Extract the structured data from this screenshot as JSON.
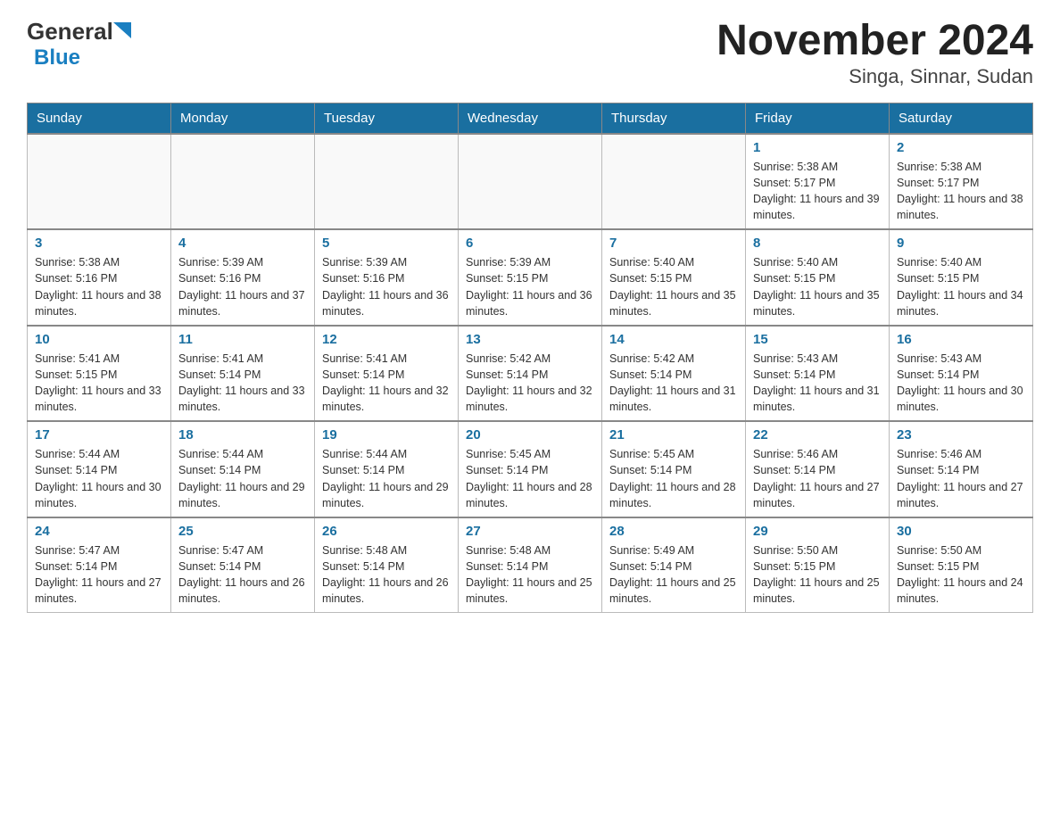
{
  "header": {
    "logo_general": "General",
    "logo_blue": "Blue",
    "title": "November 2024",
    "subtitle": "Singa, Sinnar, Sudan"
  },
  "calendar": {
    "days_of_week": [
      "Sunday",
      "Monday",
      "Tuesday",
      "Wednesday",
      "Thursday",
      "Friday",
      "Saturday"
    ],
    "weeks": [
      {
        "days": [
          {
            "date": "",
            "info": ""
          },
          {
            "date": "",
            "info": ""
          },
          {
            "date": "",
            "info": ""
          },
          {
            "date": "",
            "info": ""
          },
          {
            "date": "",
            "info": ""
          },
          {
            "date": "1",
            "info": "Sunrise: 5:38 AM\nSunset: 5:17 PM\nDaylight: 11 hours and 39 minutes."
          },
          {
            "date": "2",
            "info": "Sunrise: 5:38 AM\nSunset: 5:17 PM\nDaylight: 11 hours and 38 minutes."
          }
        ]
      },
      {
        "days": [
          {
            "date": "3",
            "info": "Sunrise: 5:38 AM\nSunset: 5:16 PM\nDaylight: 11 hours and 38 minutes."
          },
          {
            "date": "4",
            "info": "Sunrise: 5:39 AM\nSunset: 5:16 PM\nDaylight: 11 hours and 37 minutes."
          },
          {
            "date": "5",
            "info": "Sunrise: 5:39 AM\nSunset: 5:16 PM\nDaylight: 11 hours and 36 minutes."
          },
          {
            "date": "6",
            "info": "Sunrise: 5:39 AM\nSunset: 5:15 PM\nDaylight: 11 hours and 36 minutes."
          },
          {
            "date": "7",
            "info": "Sunrise: 5:40 AM\nSunset: 5:15 PM\nDaylight: 11 hours and 35 minutes."
          },
          {
            "date": "8",
            "info": "Sunrise: 5:40 AM\nSunset: 5:15 PM\nDaylight: 11 hours and 35 minutes."
          },
          {
            "date": "9",
            "info": "Sunrise: 5:40 AM\nSunset: 5:15 PM\nDaylight: 11 hours and 34 minutes."
          }
        ]
      },
      {
        "days": [
          {
            "date": "10",
            "info": "Sunrise: 5:41 AM\nSunset: 5:15 PM\nDaylight: 11 hours and 33 minutes."
          },
          {
            "date": "11",
            "info": "Sunrise: 5:41 AM\nSunset: 5:14 PM\nDaylight: 11 hours and 33 minutes."
          },
          {
            "date": "12",
            "info": "Sunrise: 5:41 AM\nSunset: 5:14 PM\nDaylight: 11 hours and 32 minutes."
          },
          {
            "date": "13",
            "info": "Sunrise: 5:42 AM\nSunset: 5:14 PM\nDaylight: 11 hours and 32 minutes."
          },
          {
            "date": "14",
            "info": "Sunrise: 5:42 AM\nSunset: 5:14 PM\nDaylight: 11 hours and 31 minutes."
          },
          {
            "date": "15",
            "info": "Sunrise: 5:43 AM\nSunset: 5:14 PM\nDaylight: 11 hours and 31 minutes."
          },
          {
            "date": "16",
            "info": "Sunrise: 5:43 AM\nSunset: 5:14 PM\nDaylight: 11 hours and 30 minutes."
          }
        ]
      },
      {
        "days": [
          {
            "date": "17",
            "info": "Sunrise: 5:44 AM\nSunset: 5:14 PM\nDaylight: 11 hours and 30 minutes."
          },
          {
            "date": "18",
            "info": "Sunrise: 5:44 AM\nSunset: 5:14 PM\nDaylight: 11 hours and 29 minutes."
          },
          {
            "date": "19",
            "info": "Sunrise: 5:44 AM\nSunset: 5:14 PM\nDaylight: 11 hours and 29 minutes."
          },
          {
            "date": "20",
            "info": "Sunrise: 5:45 AM\nSunset: 5:14 PM\nDaylight: 11 hours and 28 minutes."
          },
          {
            "date": "21",
            "info": "Sunrise: 5:45 AM\nSunset: 5:14 PM\nDaylight: 11 hours and 28 minutes."
          },
          {
            "date": "22",
            "info": "Sunrise: 5:46 AM\nSunset: 5:14 PM\nDaylight: 11 hours and 27 minutes."
          },
          {
            "date": "23",
            "info": "Sunrise: 5:46 AM\nSunset: 5:14 PM\nDaylight: 11 hours and 27 minutes."
          }
        ]
      },
      {
        "days": [
          {
            "date": "24",
            "info": "Sunrise: 5:47 AM\nSunset: 5:14 PM\nDaylight: 11 hours and 27 minutes."
          },
          {
            "date": "25",
            "info": "Sunrise: 5:47 AM\nSunset: 5:14 PM\nDaylight: 11 hours and 26 minutes."
          },
          {
            "date": "26",
            "info": "Sunrise: 5:48 AM\nSunset: 5:14 PM\nDaylight: 11 hours and 26 minutes."
          },
          {
            "date": "27",
            "info": "Sunrise: 5:48 AM\nSunset: 5:14 PM\nDaylight: 11 hours and 25 minutes."
          },
          {
            "date": "28",
            "info": "Sunrise: 5:49 AM\nSunset: 5:14 PM\nDaylight: 11 hours and 25 minutes."
          },
          {
            "date": "29",
            "info": "Sunrise: 5:50 AM\nSunset: 5:15 PM\nDaylight: 11 hours and 25 minutes."
          },
          {
            "date": "30",
            "info": "Sunrise: 5:50 AM\nSunset: 5:15 PM\nDaylight: 11 hours and 24 minutes."
          }
        ]
      }
    ]
  }
}
